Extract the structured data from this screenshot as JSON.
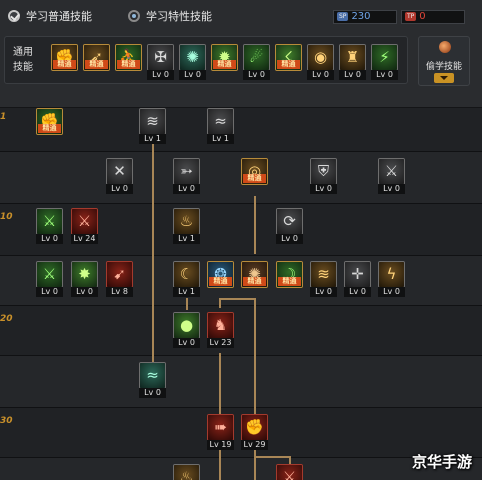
{
  "tabs": [
    {
      "label": "学习普通技能",
      "selected": true
    },
    {
      "label": "学习特性技能",
      "selected": false
    }
  ],
  "counters": [
    {
      "tag": "SP",
      "tag_color": "#4a6ea8",
      "value": "230",
      "value_color": "#6fa3e6"
    },
    {
      "tag": "TP",
      "tag_color": "#b0382e",
      "value": "0",
      "value_color": "#e0463a"
    }
  ],
  "common_panel": {
    "label": "通用技能",
    "skills": [
      {
        "icon": "muscle-icon",
        "glyph": "✊",
        "color": "c-gold",
        "frame": "gold",
        "badge": "精通",
        "level": ""
      },
      {
        "icon": "dash-icon",
        "glyph": "➶",
        "color": "c-gold",
        "frame": "gold",
        "badge": "精通",
        "level": ""
      },
      {
        "icon": "runner-icon",
        "glyph": "⛹",
        "color": "c-green",
        "frame": "gold",
        "badge": "精通",
        "level": ""
      },
      {
        "icon": "wings-icon",
        "glyph": "✠",
        "color": "c-gray",
        "frame": "gray",
        "badge": "",
        "level": "Lv 0"
      },
      {
        "icon": "compass-icon",
        "glyph": "✺",
        "color": "c-teal",
        "frame": "gray",
        "badge": "",
        "level": "Lv 0"
      },
      {
        "icon": "star-burst-icon",
        "glyph": "✹",
        "color": "c-green2",
        "frame": "gold",
        "badge": "精通",
        "level": ""
      },
      {
        "icon": "leap-icon",
        "glyph": "☄",
        "color": "c-green",
        "frame": "gray",
        "badge": "",
        "level": "Lv 0"
      },
      {
        "icon": "strike-icon",
        "glyph": "☇",
        "color": "c-green2",
        "frame": "gold",
        "badge": "精通",
        "level": ""
      },
      {
        "icon": "ring-icon",
        "glyph": "◉",
        "color": "c-gold",
        "frame": "gray",
        "badge": "",
        "level": "Lv 0"
      },
      {
        "icon": "warrior-icon",
        "glyph": "♜",
        "color": "c-gold",
        "frame": "gray",
        "badge": "",
        "level": "Lv 0"
      },
      {
        "icon": "jump-icon",
        "glyph": "⚡",
        "color": "c-green",
        "frame": "gray",
        "badge": "",
        "level": "Lv 0"
      }
    ]
  },
  "steal_panel": {
    "label": "偷学技能"
  },
  "level_marks": [
    "1",
    "10",
    "20",
    "30"
  ],
  "tree": [
    {
      "icon": "shield-bash-icon",
      "glyph": "✊",
      "color": "c-green",
      "frame": "gold",
      "badge": "精通",
      "level": ""
    },
    {
      "icon": "claw-slash-icon",
      "glyph": "≋",
      "color": "c-gray",
      "frame": "gray",
      "badge": "",
      "level": "Lv 1"
    },
    {
      "icon": "wave-slash-icon",
      "glyph": "≈",
      "color": "c-gray",
      "frame": "gray",
      "badge": "",
      "level": "Lv 1"
    },
    {
      "icon": "twin-blade-icon",
      "glyph": "✕",
      "color": "c-gray",
      "frame": "gray",
      "badge": "",
      "level": "Lv 0"
    },
    {
      "icon": "pierce-icon",
      "glyph": "➳",
      "color": "c-gray",
      "frame": "gray",
      "badge": "",
      "level": "Lv 0"
    },
    {
      "icon": "whirl-icon",
      "glyph": "◎",
      "color": "c-gold",
      "frame": "gold",
      "badge": "精通",
      "level": ""
    },
    {
      "icon": "guard-icon",
      "glyph": "⛨",
      "color": "c-gray",
      "frame": "gray",
      "badge": "",
      "level": "Lv 0"
    },
    {
      "icon": "triple-blade-icon",
      "glyph": "⚔",
      "color": "c-gray",
      "frame": "gray",
      "badge": "",
      "level": "Lv 0"
    },
    {
      "icon": "green-sword-icon",
      "glyph": "⚔",
      "color": "c-green",
      "frame": "gray",
      "badge": "",
      "level": "Lv 0"
    },
    {
      "icon": "red-sword-icon",
      "glyph": "⚔",
      "color": "c-red",
      "frame": "red",
      "badge": "",
      "level": "Lv 24"
    },
    {
      "icon": "flame-burst-icon",
      "glyph": "♨",
      "color": "c-gold",
      "frame": "gray",
      "badge": "",
      "level": "Lv 1"
    },
    {
      "icon": "spiral-icon",
      "glyph": "⟳",
      "color": "c-gray",
      "frame": "gray",
      "badge": "",
      "level": "Lv 0"
    },
    {
      "icon": "green-blade-icon",
      "glyph": "⚔",
      "color": "c-green",
      "frame": "gray",
      "badge": "",
      "level": "Lv 0"
    },
    {
      "icon": "green-spark-icon",
      "glyph": "✸",
      "color": "c-green2",
      "frame": "gray",
      "badge": "",
      "level": "Lv 0"
    },
    {
      "icon": "red-lance-icon",
      "glyph": "➹",
      "color": "c-red",
      "frame": "red",
      "badge": "",
      "level": "Lv 8"
    },
    {
      "icon": "moon-slash-icon",
      "glyph": "☾",
      "color": "c-gold",
      "frame": "gray",
      "badge": "",
      "level": "Lv 1"
    },
    {
      "icon": "blue-aura-icon",
      "glyph": "❂",
      "color": "c-blue",
      "frame": "gold",
      "badge": "精通",
      "level": ""
    },
    {
      "icon": "storm-icon",
      "glyph": "✺",
      "color": "c-brown",
      "frame": "gold",
      "badge": "精通",
      "level": ""
    },
    {
      "icon": "crescent-icon",
      "glyph": "☽",
      "color": "c-green",
      "frame": "gold",
      "badge": "精通",
      "level": ""
    },
    {
      "icon": "cyclone-icon",
      "glyph": "≋",
      "color": "c-gold",
      "frame": "gray",
      "badge": "",
      "level": "Lv 0"
    },
    {
      "icon": "cross-blade-icon",
      "glyph": "✛",
      "color": "c-gray",
      "frame": "gray",
      "badge": "",
      "level": "Lv 0"
    },
    {
      "icon": "thunder-icon",
      "glyph": "ϟ",
      "color": "c-gold",
      "frame": "gray",
      "badge": "",
      "level": "Lv 0"
    },
    {
      "icon": "green-orb-icon",
      "glyph": "●",
      "color": "c-green2",
      "frame": "gray",
      "badge": "",
      "level": "Lv 0"
    },
    {
      "icon": "berserker-icon",
      "glyph": "♞",
      "color": "c-red",
      "frame": "red",
      "badge": "",
      "level": "Lv 23"
    },
    {
      "icon": "green-whirl-icon",
      "glyph": "≈",
      "color": "c-teal",
      "frame": "gray",
      "badge": "",
      "level": "Lv 0"
    },
    {
      "icon": "fire-dash-icon",
      "glyph": "➠",
      "color": "c-red",
      "frame": "red",
      "badge": "",
      "level": "Lv 19"
    },
    {
      "icon": "fire-fist-icon",
      "glyph": "✊",
      "color": "c-red",
      "frame": "red",
      "badge": "",
      "level": "Lv 29"
    },
    {
      "icon": "flame-icon",
      "glyph": "♨",
      "color": "c-gold",
      "frame": "gray",
      "badge": "",
      "level": ""
    },
    {
      "icon": "red-claw-icon",
      "glyph": "⚔",
      "color": "c-red",
      "frame": "red",
      "badge": "",
      "level": ""
    }
  ],
  "watermark": "京华手游"
}
